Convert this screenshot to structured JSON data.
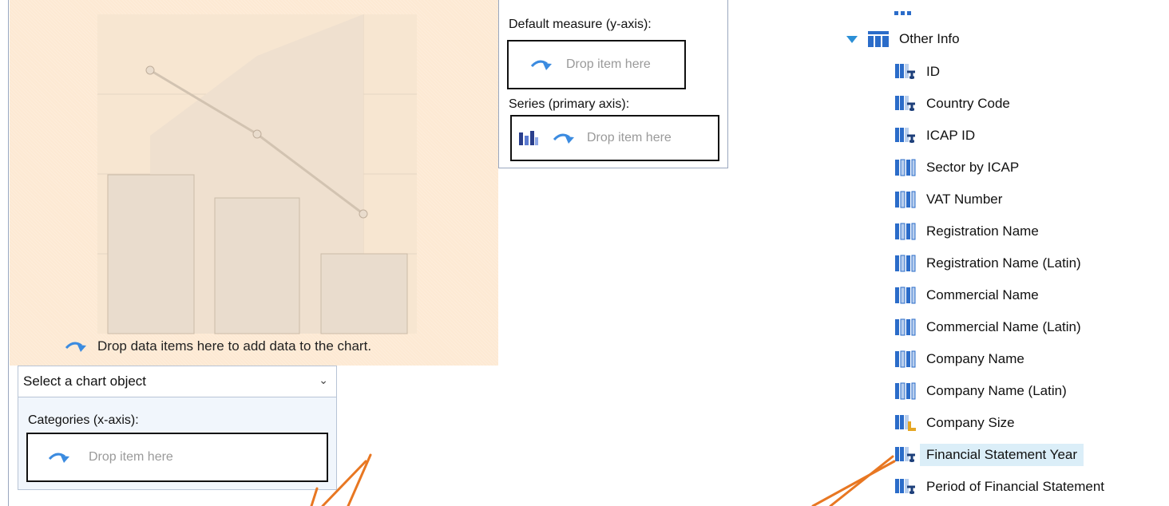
{
  "chart_area": {
    "drop_hint": "Drop data items here to add data to the chart."
  },
  "measure_panel": {
    "default_measure_label": "Default measure (y-axis):",
    "default_measure_drop": "Drop item here",
    "series_label": "Series (primary axis):",
    "series_drop": "Drop item here"
  },
  "chart_select": {
    "value": "Select a chart object"
  },
  "categories": {
    "label": "Categories (x-axis):",
    "drop": "Drop item here"
  },
  "tree": {
    "root_label": "Other Info",
    "items": [
      {
        "label": "ID",
        "icon": "field-key-icon"
      },
      {
        "label": "Country Code",
        "icon": "field-key-icon"
      },
      {
        "label": "ICAP ID",
        "icon": "field-key-icon"
      },
      {
        "label": "Sector by ICAP",
        "icon": "field-attribute-icon"
      },
      {
        "label": "VAT Number",
        "icon": "field-attribute-icon"
      },
      {
        "label": "Registration Name",
        "icon": "field-attribute-icon"
      },
      {
        "label": "Registration Name (Latin)",
        "icon": "field-attribute-icon"
      },
      {
        "label": "Commercial Name",
        "icon": "field-attribute-icon"
      },
      {
        "label": "Commercial Name (Latin)",
        "icon": "field-attribute-icon"
      },
      {
        "label": "Company Name",
        "icon": "field-attribute-icon"
      },
      {
        "label": "Company Name (Latin)",
        "icon": "field-attribute-icon"
      },
      {
        "label": "Company Size",
        "icon": "field-hierarchy-icon"
      },
      {
        "label": "Financial Statement Year",
        "icon": "field-key-icon",
        "selected": true
      },
      {
        "label": "Period of Financial Statement",
        "icon": "field-key-icon"
      }
    ]
  },
  "colors": {
    "chart_bg": "#fde9d3",
    "accent_blue": "#2b8fd6",
    "callout_orange": "#e87722",
    "selection": "#dbeef8"
  }
}
